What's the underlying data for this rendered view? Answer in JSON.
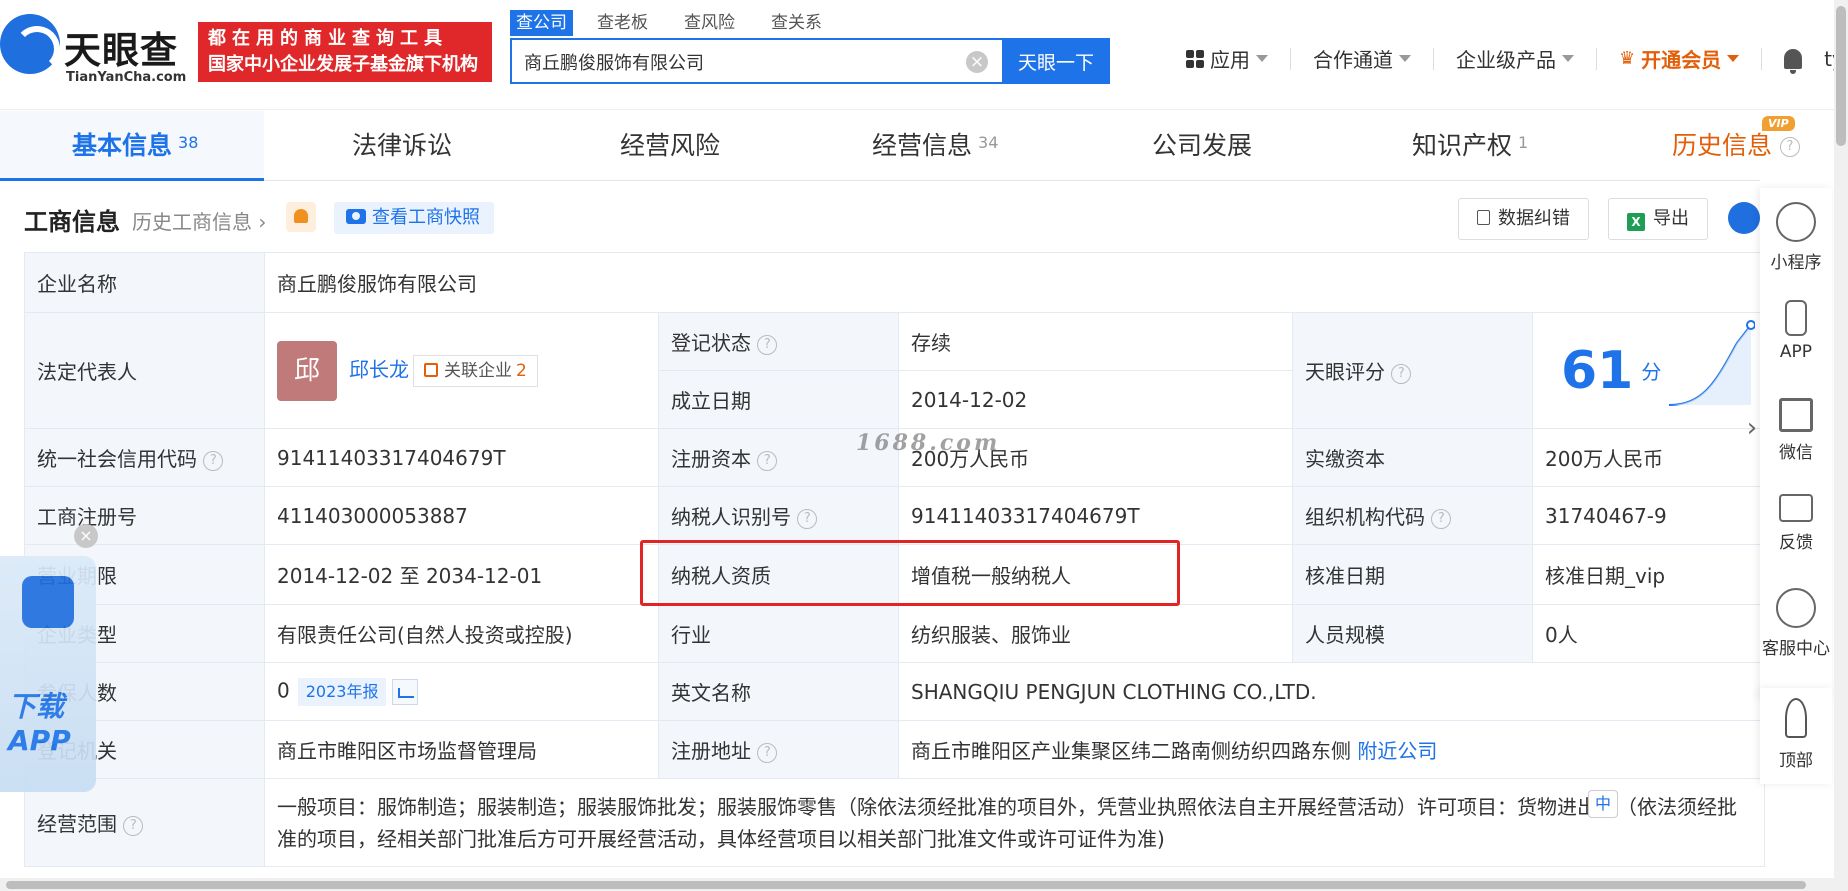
{
  "header": {
    "logo_text": "天眼查",
    "logo_sub": "TianYanCha.com",
    "slogan_line1": "都在用的商业查询工具",
    "slogan_line2": "国家中小企业发展子基金旗下机构",
    "search_tabs": [
      "查公司",
      "查老板",
      "查风险",
      "查关系"
    ],
    "search_value": "商丘鹏俊服饰有限公司",
    "search_button": "天眼一下",
    "nav_app": "应用",
    "nav_partner": "合作通道",
    "nav_enterprise": "企业级产品",
    "nav_member": "开通会员",
    "username": "tyce..."
  },
  "main_tabs": {
    "basic": "基本信息",
    "basic_count": "38",
    "legal": "法律诉讼",
    "risk": "经营风险",
    "biz": "经营信息",
    "biz_count": "34",
    "dev": "公司发展",
    "ip": "知识产权",
    "ip_count": "1",
    "history": "历史信息",
    "vip": "VIP"
  },
  "section": {
    "title": "工商信息",
    "history_link": "历史工商信息",
    "snapshot": "查看工商快照",
    "correct": "数据纠错",
    "export": "导出"
  },
  "info": {
    "company_name_label": "企业名称",
    "company_name": "商丘鹏俊服饰有限公司",
    "legal_rep_label": "法定代表人",
    "legal_rep_avatar": "邱",
    "legal_rep": "邱长龙",
    "related_label": "关联企业",
    "related_count": "2",
    "reg_status_label": "登记状态",
    "reg_status": "存续",
    "found_date_label": "成立日期",
    "found_date": "2014-12-02",
    "score_label": "天眼评分",
    "score": "61",
    "score_unit": "分",
    "credit_code_label": "统一社会信用代码",
    "credit_code": "91411403317404679T",
    "reg_capital_label": "注册资本",
    "reg_capital": "200万人民币",
    "paid_capital_label": "实缴资本",
    "paid_capital": "200万人民币",
    "reg_no_label": "工商注册号",
    "reg_no": "411403000053887",
    "taxpayer_id_label": "纳税人识别号",
    "taxpayer_id": "91411403317404679T",
    "org_code_label": "组织机构代码",
    "org_code": "31740467-9",
    "term_label": "营业期限",
    "term": "2014-12-02 至 2034-12-01",
    "tax_qual_label": "纳税人资质",
    "tax_qual": "增值税一般纳税人",
    "approve_date_label": "核准日期",
    "approve_date": "核准日期_vip",
    "type_label": "企业类型",
    "type": "有限责任公司(自然人投资或控股)",
    "industry_label": "行业",
    "industry": "纺织服装、服饰业",
    "staff_label": "人员规模",
    "staff": "0人",
    "insured_label": "参保人数",
    "insured": "0",
    "insured_year": "2023年报",
    "en_name_label": "英文名称",
    "en_name": "SHANGQIU PENGJUN CLOTHING CO.,LTD.",
    "authority_label": "登记机关",
    "authority": "商丘市睢阳区市场监督管理局",
    "address_label": "注册地址",
    "address": "商丘市睢阳区产业集聚区纬二路南侧纺织四路东侧",
    "nearby": "附近公司",
    "scope_label": "经营范围",
    "scope": "一般项目：服饰制造；服装制造；服装服饰批发；服装服饰零售（除依法须经批准的项目外，凭营业执照依法自主开展经营活动）许可项目：货物进出口（依法须经批准的项目，经相关部门批准后方可开展经营活动，具体经营项目以相关部门批准文件或许可证件为准)"
  },
  "watermark": "1688.com",
  "sidebar": {
    "mini": "小程序",
    "app": "APP",
    "wechat": "微信",
    "feedback": "反馈",
    "service": "客服中心",
    "top": "顶部"
  },
  "download": {
    "text1": "下载",
    "text2": "APP"
  },
  "ime": "中"
}
